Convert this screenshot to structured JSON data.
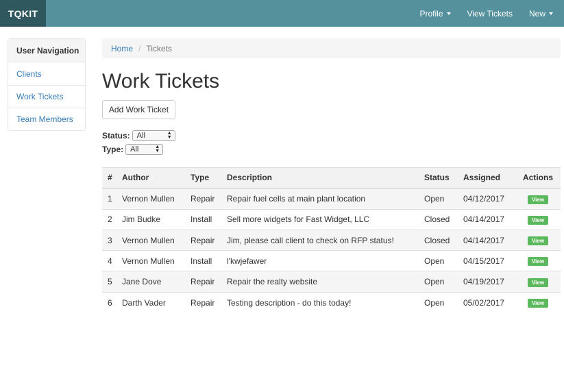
{
  "navbar": {
    "brand": "TQKIT",
    "items": [
      {
        "label": "Profile",
        "has_caret": true
      },
      {
        "label": "View Tickets",
        "has_caret": false
      },
      {
        "label": "New",
        "has_caret": true
      }
    ],
    "color": "#55919c",
    "brand_color": "#2e575e"
  },
  "sidebar": {
    "heading": "User Navigation",
    "items": [
      {
        "label": "Clients"
      },
      {
        "label": "Work Tickets"
      },
      {
        "label": "Team Members"
      }
    ]
  },
  "breadcrumb": {
    "home": "Home",
    "separator": "/",
    "current": "Tickets"
  },
  "page": {
    "title": "Work Tickets",
    "add_button": "Add Work Ticket"
  },
  "filters": {
    "status": {
      "label": "Status:",
      "value": "All"
    },
    "type": {
      "label": "Type:",
      "value": "All"
    }
  },
  "table": {
    "columns": [
      "#",
      "Author",
      "Type",
      "Description",
      "Status",
      "Assigned",
      "Actions"
    ],
    "action_label": "View",
    "action_color": "#5cb85c",
    "rows": [
      {
        "id": "1",
        "author": "Vernon Mullen",
        "type": "Repair",
        "description": "Repair fuel cells at main plant location",
        "status": "Open",
        "assigned": "04/12/2017"
      },
      {
        "id": "2",
        "author": "Jim Budke",
        "type": "Install",
        "description": "Sell more widgets for Fast Widget, LLC",
        "status": "Closed",
        "assigned": "04/14/2017"
      },
      {
        "id": "3",
        "author": "Vernon Mullen",
        "type": "Repair",
        "description": "Jim, please call client to check on RFP status!",
        "status": "Closed",
        "assigned": "04/14/2017"
      },
      {
        "id": "4",
        "author": "Vernon Mullen",
        "type": "Install",
        "description": "l'kwjefawer",
        "status": "Open",
        "assigned": "04/15/2017"
      },
      {
        "id": "5",
        "author": "Jane Dove",
        "type": "Repair",
        "description": "Repair the realty website",
        "status": "Open",
        "assigned": "04/19/2017"
      },
      {
        "id": "6",
        "author": "Darth Vader",
        "type": "Repair",
        "description": "Testing description - do this today!",
        "status": "Open",
        "assigned": "05/02/2017"
      }
    ]
  }
}
